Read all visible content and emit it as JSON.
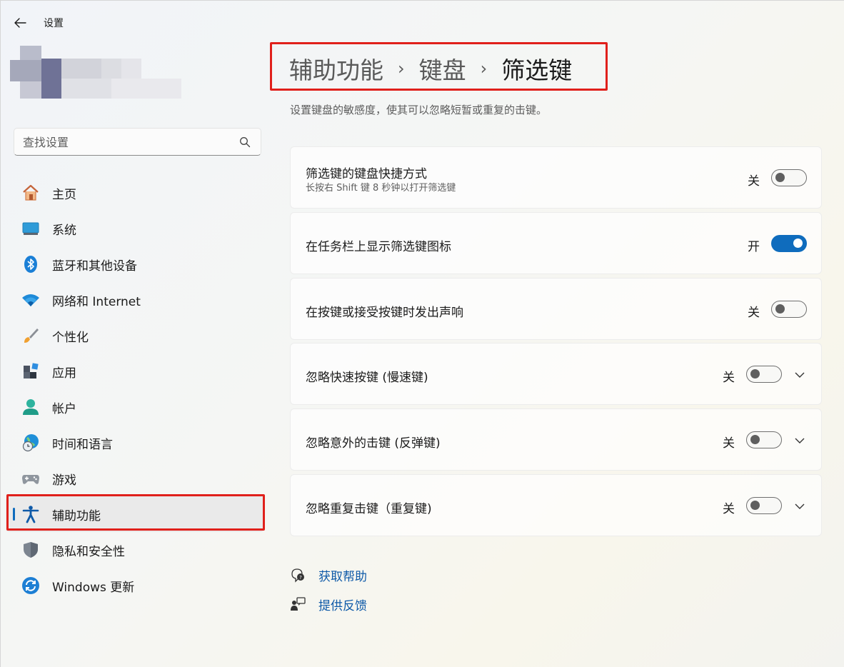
{
  "window": {
    "title": "设置"
  },
  "search": {
    "placeholder": "查找设置"
  },
  "sidebar": {
    "items": [
      {
        "label": "主页",
        "icon": "home-icon"
      },
      {
        "label": "系统",
        "icon": "system-icon"
      },
      {
        "label": "蓝牙和其他设备",
        "icon": "bluetooth-icon"
      },
      {
        "label": "网络和 Internet",
        "icon": "wifi-icon"
      },
      {
        "label": "个性化",
        "icon": "brush-icon"
      },
      {
        "label": "应用",
        "icon": "apps-icon"
      },
      {
        "label": "帐户",
        "icon": "account-icon"
      },
      {
        "label": "时间和语言",
        "icon": "globe-clock-icon"
      },
      {
        "label": "游戏",
        "icon": "gamepad-icon"
      },
      {
        "label": "辅助功能",
        "icon": "accessibility-icon",
        "selected": true
      },
      {
        "label": "隐私和安全性",
        "icon": "shield-icon"
      },
      {
        "label": "Windows 更新",
        "icon": "update-icon"
      }
    ]
  },
  "breadcrumb": {
    "items": [
      "辅助功能",
      "键盘",
      "筛选键"
    ],
    "separator": "›"
  },
  "page": {
    "subtitle": "设置键盘的敏感度，使其可以忽略短暂或重复的击键。"
  },
  "settings": [
    {
      "title": "筛选键的键盘快捷方式",
      "description": "长按右 Shift 键 8 秒钟以打开筛选键",
      "state_label": "关",
      "on": false,
      "expandable": false
    },
    {
      "title": "在任务栏上显示筛选键图标",
      "state_label": "开",
      "on": true,
      "expandable": false
    },
    {
      "title": "在按键或接受按键时发出声响",
      "state_label": "关",
      "on": false,
      "expandable": false
    },
    {
      "title": "忽略快速按键 (慢速键)",
      "state_label": "关",
      "on": false,
      "expandable": true
    },
    {
      "title": "忽略意外的击键 (反弹键)",
      "state_label": "关",
      "on": false,
      "expandable": true
    },
    {
      "title": "忽略重复击键（重复键)",
      "state_label": "关",
      "on": false,
      "expandable": true
    }
  ],
  "links": {
    "help": "获取帮助",
    "feedback": "提供反馈"
  },
  "colors": {
    "accent": "#0f6cbd",
    "highlight_box": "#e0201b"
  }
}
